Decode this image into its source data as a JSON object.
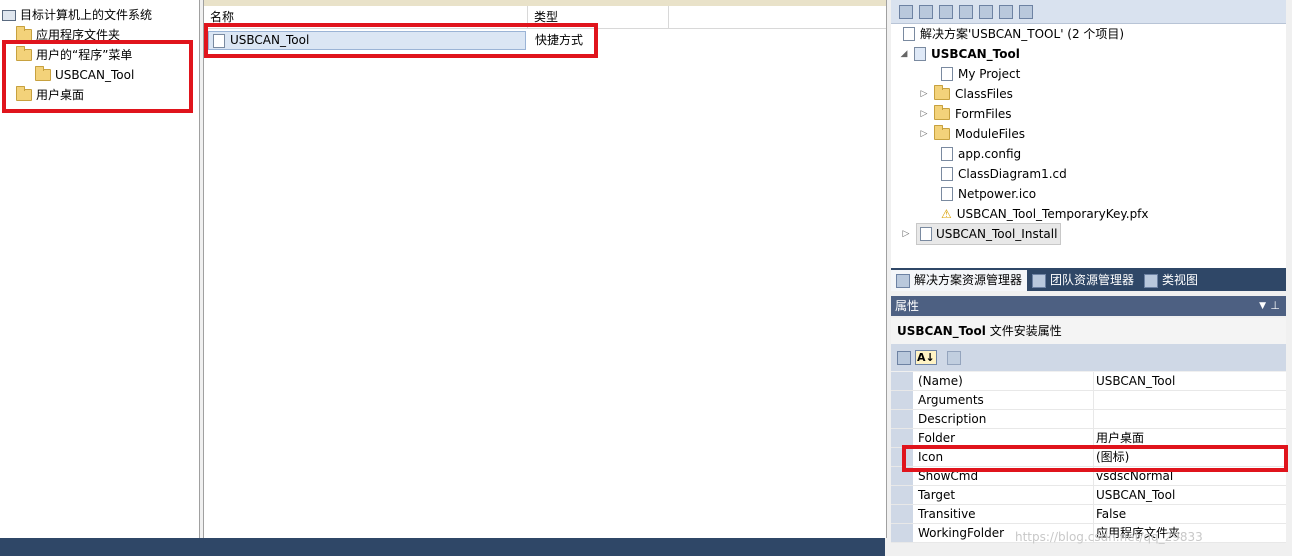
{
  "left_tree": {
    "root": "目标计算机上的文件系统",
    "items": [
      "应用程序文件夹",
      "用户的“程序”菜单",
      "USBCAN_Tool",
      "用户桌面"
    ]
  },
  "middle": {
    "col_name": "名称",
    "col_type": "类型",
    "row": {
      "name": "USBCAN_Tool",
      "type": "快捷方式"
    }
  },
  "solution": {
    "title": "解决方案'USBCAN_TOOL' (2 个项目)",
    "project": "USBCAN_Tool",
    "items": [
      "My Project",
      "ClassFiles",
      "FormFiles",
      "ModuleFiles",
      "app.config",
      "ClassDiagram1.cd",
      "Netpower.ico",
      "USBCAN_Tool_TemporaryKey.pfx"
    ],
    "install_project": "USBCAN_Tool_Install"
  },
  "tabs": [
    "解决方案资源管理器",
    "团队资源管理器",
    "类视图"
  ],
  "properties": {
    "title": "属性",
    "object_name": "USBCAN_Tool",
    "object_desc": "文件安装属性",
    "rows": [
      {
        "name": "(Name)",
        "value": "USBCAN_Tool"
      },
      {
        "name": "Arguments",
        "value": ""
      },
      {
        "name": "Description",
        "value": ""
      },
      {
        "name": "Folder",
        "value": "用户桌面"
      },
      {
        "name": "Icon",
        "value": "(图标)"
      },
      {
        "name": "ShowCmd",
        "value": "vsdscNormal"
      },
      {
        "name": "Target",
        "value": "USBCAN_Tool"
      },
      {
        "name": "Transitive",
        "value": "False"
      },
      {
        "name": "WorkingFolder",
        "value": "应用程序文件夹"
      }
    ]
  },
  "watermark": "https://blog.csdn.net/qq_29833"
}
